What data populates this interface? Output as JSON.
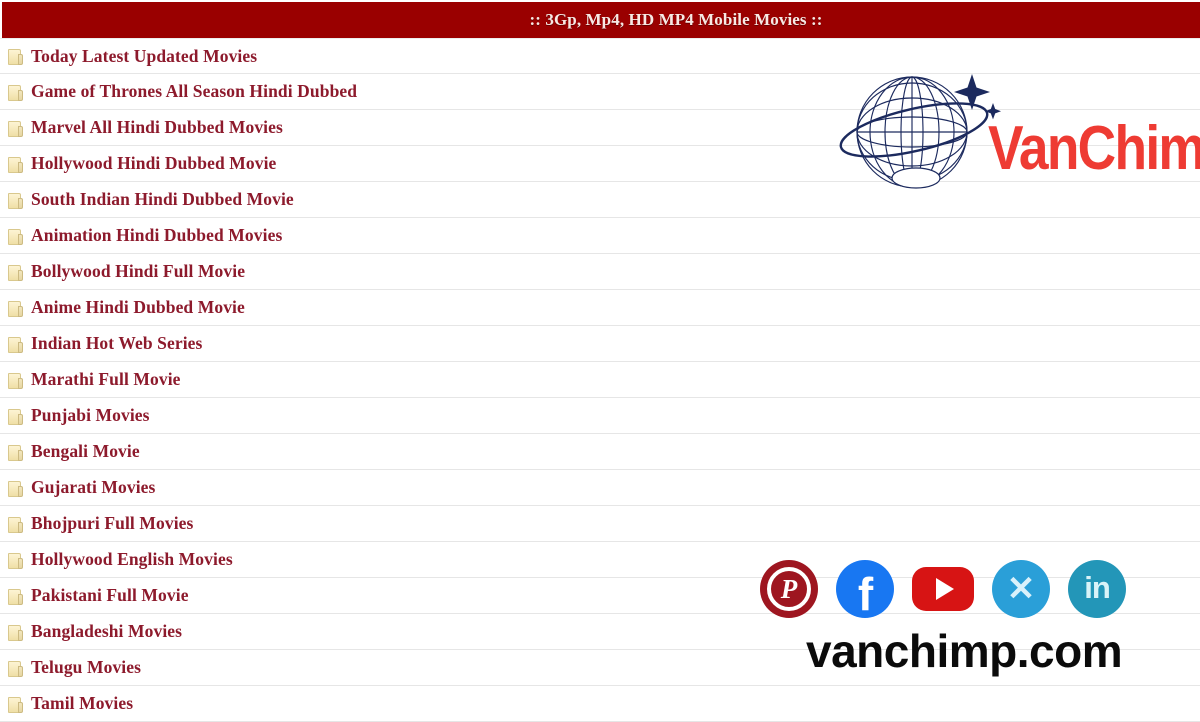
{
  "header": {
    "title": ":: 3Gp, Mp4, HD MP4 Mobile Movies ::",
    "bg_color": "#9a0000",
    "text_color": "#f7e9e4"
  },
  "list": {
    "icon": "folder-icon",
    "text_color": "#8d1a2c",
    "items": [
      {
        "label": "Today Latest Updated Movies"
      },
      {
        "label": "Game of Thrones All Season Hindi Dubbed"
      },
      {
        "label": "Marvel All Hindi Dubbed Movies"
      },
      {
        "label": "Hollywood Hindi Dubbed Movie"
      },
      {
        "label": "South Indian Hindi Dubbed Movie"
      },
      {
        "label": "Animation Hindi Dubbed Movies"
      },
      {
        "label": "Bollywood Hindi Full Movie"
      },
      {
        "label": "Anime Hindi Dubbed Movie"
      },
      {
        "label": "Indian Hot Web Series"
      },
      {
        "label": "Marathi Full Movie"
      },
      {
        "label": "Punjabi Movies"
      },
      {
        "label": "Bengali Movie"
      },
      {
        "label": "Gujarati Movies"
      },
      {
        "label": "Bhojpuri Full Movies"
      },
      {
        "label": "Hollywood English Movies"
      },
      {
        "label": "Pakistani Full Movie"
      },
      {
        "label": "Bangladeshi Movies"
      },
      {
        "label": "Telugu Movies"
      },
      {
        "label": "Tamil Movies"
      }
    ]
  },
  "watermark": {
    "logo": {
      "icon": "globe-icon",
      "wordmark": "VanChimp",
      "wordmark_color": "#ee3b33",
      "globe_color": "#1c2a5e"
    },
    "socials": [
      {
        "name": "pinterest",
        "glyph": "P",
        "color": "#9e1620"
      },
      {
        "name": "facebook",
        "glyph": "f",
        "color": "#1877f2"
      },
      {
        "name": "youtube",
        "glyph": "▶",
        "color": "#d71414"
      },
      {
        "name": "x-twitter",
        "glyph": "✕",
        "color": "#2a9fd8"
      },
      {
        "name": "linkedin",
        "glyph": "in",
        "color": "#2396b8"
      }
    ],
    "domain": "vanchimp.com"
  }
}
